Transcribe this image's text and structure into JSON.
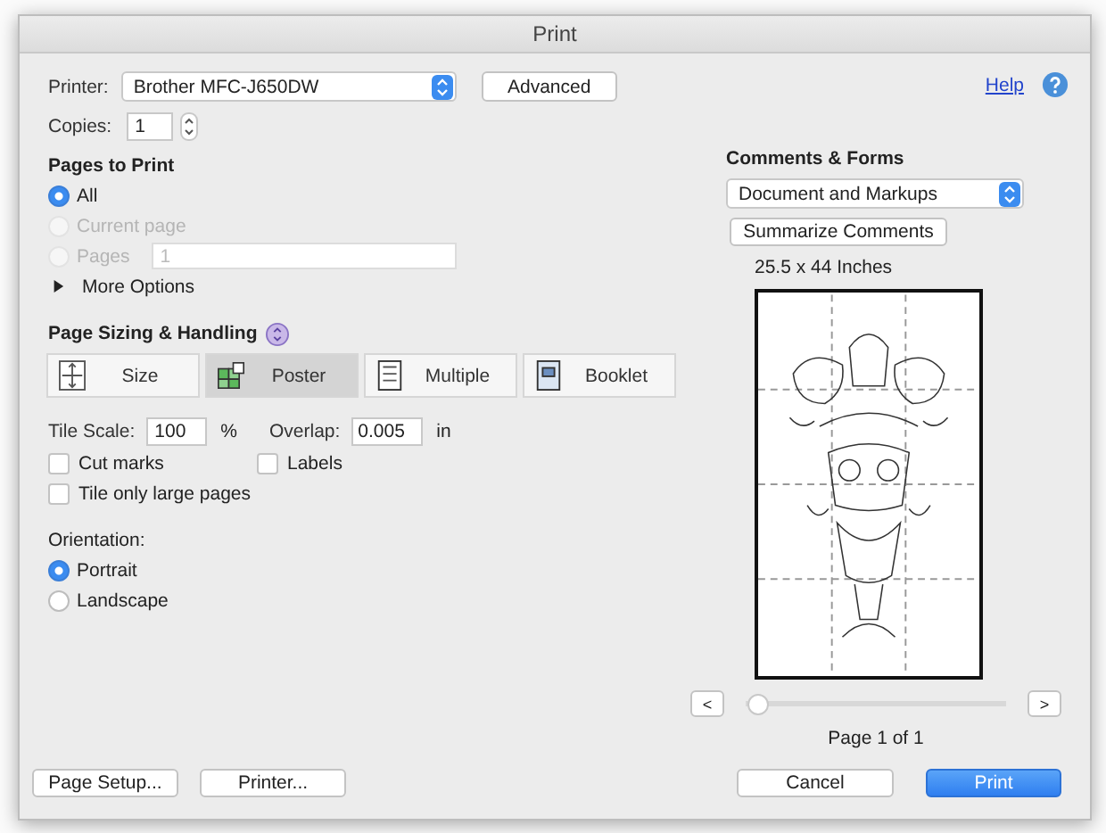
{
  "window": {
    "title": "Print"
  },
  "printer": {
    "label": "Printer:",
    "value": "Brother MFC-J650DW"
  },
  "advanced_button": "Advanced",
  "help_link": "Help",
  "copies": {
    "label": "Copies:",
    "value": "1"
  },
  "pages_to_print": {
    "title": "Pages to Print",
    "options": [
      {
        "label": "All",
        "selected": true,
        "disabled": false
      },
      {
        "label": "Current page",
        "selected": false,
        "disabled": true
      },
      {
        "label": "Pages",
        "selected": false,
        "disabled": true,
        "field_value": "1"
      }
    ],
    "more_options": {
      "label": "More Options",
      "expanded": false
    }
  },
  "sizing": {
    "title": "Page Sizing & Handling",
    "modes": [
      {
        "label": "Size",
        "selected": false,
        "kind": "size"
      },
      {
        "label": "Poster",
        "selected": true,
        "kind": "poster"
      },
      {
        "label": "Multiple",
        "selected": false,
        "kind": "multiple"
      },
      {
        "label": "Booklet",
        "selected": false,
        "kind": "booklet"
      }
    ]
  },
  "tile_scale": {
    "label": "Tile Scale:",
    "value": "100",
    "unit": "%"
  },
  "overlap": {
    "label": "Overlap:",
    "value": "0.005",
    "unit": "in"
  },
  "checkboxes": [
    {
      "label": "Cut marks",
      "checked": false
    },
    {
      "label": "Labels",
      "checked": false
    },
    {
      "label": "Tile only large pages",
      "checked": false
    }
  ],
  "orientation": {
    "label": "Orientation:",
    "options": [
      {
        "label": "Portrait",
        "selected": true
      },
      {
        "label": "Landscape",
        "selected": false
      }
    ]
  },
  "comments_forms": {
    "title": "Comments & Forms",
    "value": "Document and Markups",
    "summarize_button": "Summarize Comments"
  },
  "preview": {
    "size": "25.5 x 44 Inches",
    "prev": "<",
    "next": ">",
    "page_label": "Page 1 of 1",
    "slider": {
      "level": 0
    }
  },
  "buttons": {
    "page_setup": "Page Setup...",
    "printer": "Printer...",
    "cancel": "Cancel",
    "print": "Print"
  }
}
